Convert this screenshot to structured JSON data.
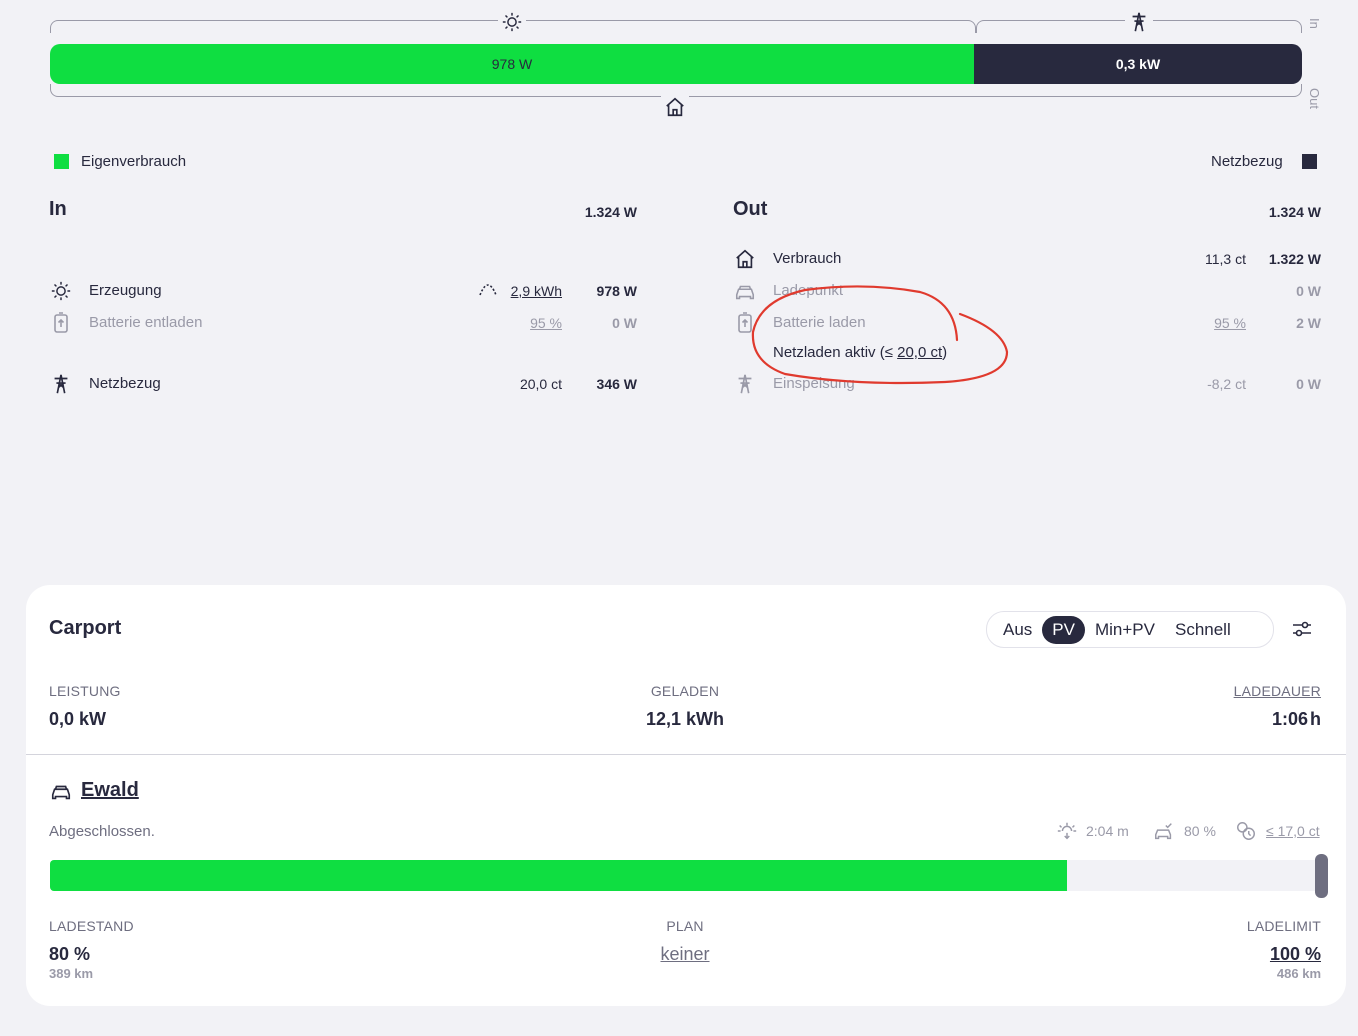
{
  "energyflow": {
    "pv_bar_label": "978 W",
    "grid_bar_label": "0,3 kW",
    "in_label": "In",
    "out_label": "Out",
    "legend_self": "Eigenverbrauch",
    "legend_grid": "Netzbezug",
    "colors": {
      "self": "#0fde41",
      "grid": "#28293e"
    }
  },
  "in_panel": {
    "title": "In",
    "total": "1.324 W",
    "rows": [
      {
        "icon": "sun-icon",
        "label": "Erzeugung",
        "info_icon": "forecast-icon",
        "info": "2,9 kWh",
        "value": "978 W"
      },
      {
        "icon": "battery-icon",
        "label": "Batterie entladen",
        "info": "95 %",
        "value": "0 W"
      },
      {
        "icon": "grid-tower-icon",
        "label": "Netzbezug",
        "info": "20,0 ct",
        "value": "346 W"
      }
    ]
  },
  "out_panel": {
    "title": "Out",
    "total": "1.324 W",
    "rows": [
      {
        "icon": "home-icon",
        "label": "Verbrauch",
        "info": "11,3 ct",
        "value": "1.322 W"
      },
      {
        "icon": "car-icon",
        "label": "Ladepunkt",
        "info": "",
        "value": "0 W"
      },
      {
        "icon": "battery-icon",
        "label": "Batterie laden",
        "info": "95 %",
        "value": "2 W"
      },
      {
        "icon": "grid-tower-icon",
        "label": "Einspeisung",
        "info": "-8,2 ct",
        "value": "0 W"
      }
    ],
    "grid_charge": {
      "prefix": "Netzladen aktiv (≤ ",
      "price": "20,0 ct",
      "suffix": ")"
    }
  },
  "loadpoint": {
    "title": "Carport",
    "modes": [
      "Aus",
      "PV",
      "Min+PV",
      "Schnell"
    ],
    "active_mode": "PV",
    "stats": [
      {
        "caption": "LEISTUNG",
        "value": "0,0 kW"
      },
      {
        "caption": "GELADEN",
        "value": "12,1 kWh"
      },
      {
        "caption": "LADEDAUER",
        "value": "1:06",
        "unit": "h"
      }
    ]
  },
  "vehicle": {
    "name": "Ewald",
    "status": "Abgeschlossen.",
    "badges": [
      {
        "icon": "sun-timer-icon",
        "text": "2:04 m"
      },
      {
        "icon": "car-limit-icon",
        "text": "80 %"
      },
      {
        "icon": "coin-clock-icon",
        "text": "≤ 17,0 ct"
      }
    ],
    "soc_fraction": 0.8,
    "bottom": [
      {
        "caption": "LADESTAND",
        "value": "80 %",
        "sub": "389 km"
      },
      {
        "caption": "PLAN",
        "value": "keiner"
      },
      {
        "caption": "LADELIMIT",
        "value": "100 %",
        "sub": "486 km"
      }
    ]
  }
}
